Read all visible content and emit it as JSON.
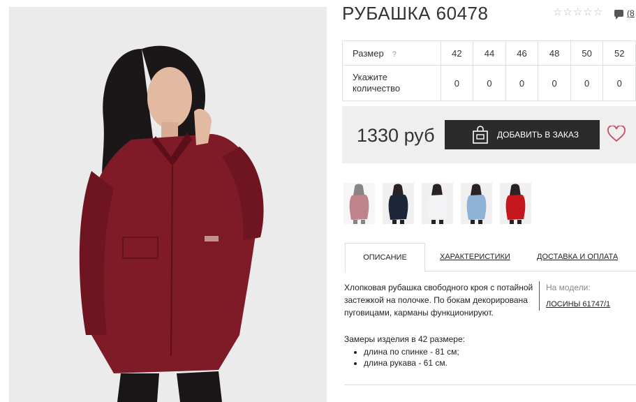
{
  "product": {
    "title": "РУБАШКА 60478",
    "rating_stars": 5,
    "rating_filled": 0,
    "comments_count": "(8"
  },
  "sizes": {
    "size_label": "Размер",
    "help_mark": "?",
    "values": [
      "42",
      "44",
      "46",
      "48",
      "50",
      "52"
    ],
    "qty_label": "Укажите количество",
    "quantities": [
      "0",
      "0",
      "0",
      "0",
      "0",
      "0"
    ]
  },
  "buy": {
    "price": "1330 руб",
    "add_button": "ДОБАВИТЬ В ЗАКАЗ",
    "accent": "#c94a63"
  },
  "thumbnails": [
    {
      "name": "burgundy",
      "color": "#8b1e2e"
    },
    {
      "name": "navy",
      "color": "#1d2638"
    },
    {
      "name": "white",
      "color": "#f3f3f6"
    },
    {
      "name": "light-blue",
      "color": "#8fb3d6"
    },
    {
      "name": "red",
      "color": "#c4161c"
    }
  ],
  "tabs": [
    "ОПИСАНИЕ",
    "ХАРАКТЕРИСТИКИ",
    "ДОСТАВКА И ОПЛАТА"
  ],
  "description": {
    "text": "Хлопковая рубашка свободного кроя с потайной застежкой на полочке. По бокам декорирована пуговицами, карманы функционируют.",
    "model_label": "На модели:",
    "model_link": "ЛОСИНЫ 61747/1",
    "measures_title": "Замеры изделия в 42 размере:",
    "measures": [
      "длина по спинке - 81 см;",
      "длина рукава - 61 см."
    ]
  }
}
